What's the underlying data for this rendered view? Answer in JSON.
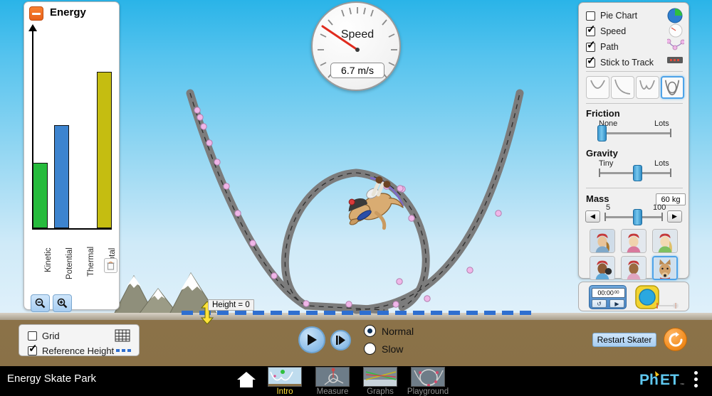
{
  "app": {
    "title": "Energy Skate Park",
    "logo": "PhET",
    "kebab_menu": "kebab-menu"
  },
  "energy_panel": {
    "title": "Energy",
    "collapse_icon": "minus-icon",
    "trash_icon": "trash-icon",
    "zoom_out_icon": "zoom-out-icon",
    "zoom_in_icon": "zoom-in-icon"
  },
  "chart_data": {
    "type": "bar",
    "title": "Energy",
    "categories": [
      "Kinetic",
      "Potential",
      "Thermal",
      "Total"
    ],
    "values": [
      33,
      52,
      0,
      79
    ],
    "colors": [
      "#26bb3c",
      "#3d84cf",
      "#e08a2e",
      "#c5bd11"
    ],
    "xlabel": "",
    "ylabel": "",
    "ylim": [
      0,
      100
    ],
    "grid": false,
    "legend": "none"
  },
  "speedometer": {
    "label": "Speed",
    "value": "6.7 m/s",
    "needle_angle": -38
  },
  "height_marker": {
    "label": "Height = 0"
  },
  "control_panel": {
    "checkboxes": [
      {
        "label": "Pie Chart",
        "checked": false,
        "icon": "pie-chart-icon"
      },
      {
        "label": "Speed",
        "checked": true,
        "icon": "speedometer-icon"
      },
      {
        "label": "Path",
        "checked": true,
        "icon": "path-icon"
      },
      {
        "label": "Stick to Track",
        "checked": true,
        "icon": "track-icon"
      }
    ],
    "track_presets": [
      {
        "name": "v-track-icon",
        "selected": false
      },
      {
        "name": "ramp-track-icon",
        "selected": false
      },
      {
        "name": "w-track-icon",
        "selected": false
      },
      {
        "name": "loop-track-icon",
        "selected": true
      }
    ],
    "friction": {
      "title": "Friction",
      "min_label": "None",
      "max_label": "Lots",
      "value_pct": 4
    },
    "gravity": {
      "title": "Gravity",
      "min_label": "Tiny",
      "max_label": "Lots",
      "value_pct": 53
    },
    "mass": {
      "title": "Mass",
      "value": "60 kg",
      "min_label": "5",
      "max_label": "100",
      "value_pct": 57,
      "left_arrow": "◀",
      "right_arrow": "▶"
    },
    "characters": [
      {
        "name": "skater-girl-1",
        "selected": false
      },
      {
        "name": "skater-boy-1",
        "selected": false
      },
      {
        "name": "skater-girl-2",
        "selected": false
      },
      {
        "name": "skater-girl-3",
        "selected": false
      },
      {
        "name": "skater-boy-2",
        "selected": false
      },
      {
        "name": "dog",
        "selected": true
      }
    ]
  },
  "timer_panel": {
    "stopwatch_time": "00:00",
    "stopwatch_centis": "00",
    "reset_icon": "↺",
    "play_icon": "▶",
    "measuring_tape_icon": "measuring-tape-icon"
  },
  "bottom_controls": {
    "grid": {
      "label": "Grid",
      "checked": false,
      "icon": "grid-icon"
    },
    "reference_height": {
      "label": "Reference Height",
      "checked": true,
      "icon": "dashed-line-icon"
    },
    "play_icon": "play-icon",
    "step_icon": "step-forward-icon",
    "speed_options": [
      {
        "label": "Normal",
        "selected": true
      },
      {
        "label": "Slow",
        "selected": false
      }
    ],
    "restart_skater": "Restart Skater",
    "reset_all_icon": "reset-all-icon"
  },
  "nav": {
    "home_icon": "home-icon",
    "tabs": [
      {
        "label": "Intro",
        "selected": true
      },
      {
        "label": "Measure",
        "selected": false
      },
      {
        "label": "Graphs",
        "selected": false
      },
      {
        "label": "Playground",
        "selected": false
      }
    ]
  },
  "colors": {
    "accent": "#4ea3e8",
    "sky": "#55c3ee",
    "ground": "#8a7147",
    "kinetic": "#26bb3c",
    "potential": "#3d84cf",
    "total": "#c5bd11",
    "orange": "#f28c1e",
    "tab_selected": "#ffdf38"
  }
}
